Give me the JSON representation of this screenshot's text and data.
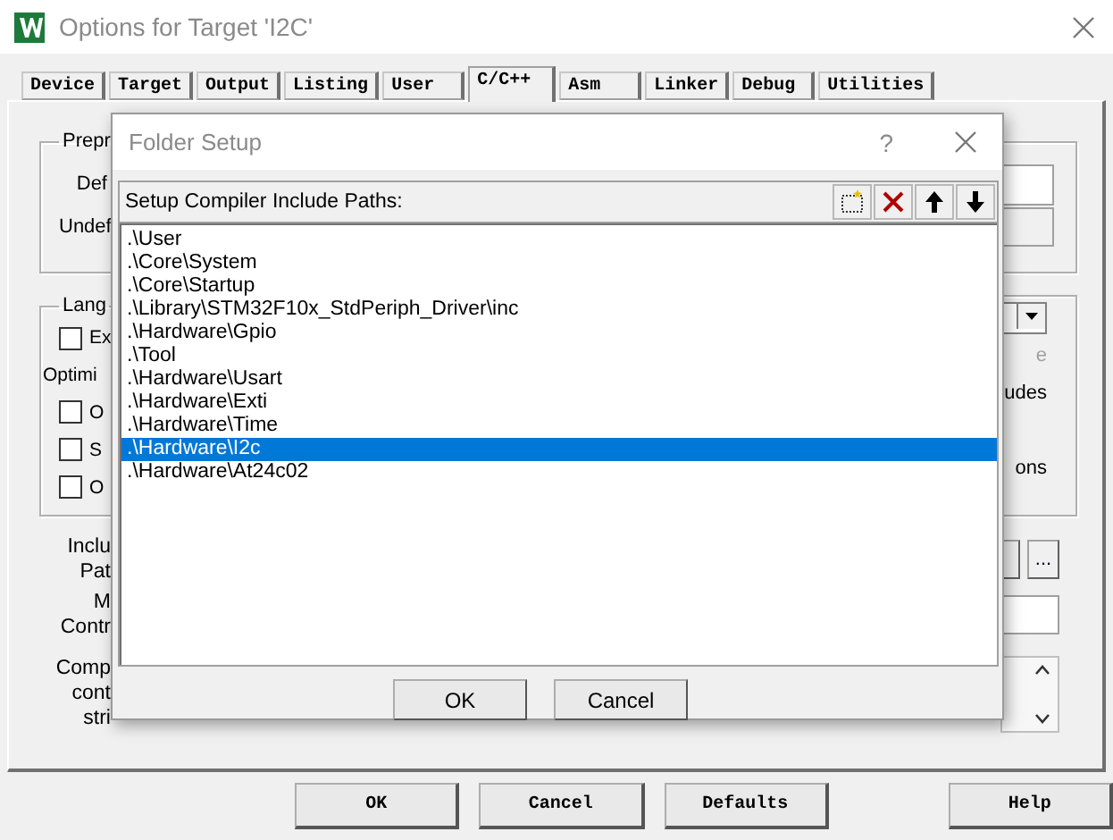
{
  "window": {
    "title": "Options for Target 'I2C'"
  },
  "tabs": [
    {
      "label": "Device",
      "selected": false
    },
    {
      "label": "Target",
      "selected": false
    },
    {
      "label": "Output",
      "selected": false
    },
    {
      "label": "Listing",
      "selected": false
    },
    {
      "label": "User",
      "selected": false
    },
    {
      "label": "C/C++",
      "selected": true
    },
    {
      "label": "Asm",
      "selected": false
    },
    {
      "label": "Linker",
      "selected": false
    },
    {
      "label": "Debug",
      "selected": false
    },
    {
      "label": "Utilities",
      "selected": false
    }
  ],
  "preprocessor": {
    "legend": "Prepr",
    "define_label": "Def",
    "undefine_label": "Undef"
  },
  "language": {
    "legend": "Lang",
    "rows": [
      {
        "left": {
          "kind": "checkbox",
          "label": "Ex",
          "checked": false
        },
        "right": {
          "kind": "dropdown"
        }
      },
      {
        "left": {
          "kind": "label",
          "label": "Optimi"
        },
        "right": {
          "kind": "label",
          "label": "e",
          "disabled": true
        }
      },
      {
        "left": {
          "kind": "checkbox",
          "label": "O",
          "checked": false
        },
        "right": {
          "kind": "label",
          "label": "udes",
          "disabled": false
        }
      },
      {
        "left": {
          "kind": "checkbox",
          "label": "S",
          "checked": false
        }
      },
      {
        "left": {
          "kind": "checkbox",
          "label": "O",
          "checked": false
        },
        "right": {
          "kind": "label",
          "label": "ons",
          "disabled": false
        }
      }
    ]
  },
  "include_paths": {
    "label_lines": [
      "Inclu",
      "Pat"
    ],
    "browse_button": "..."
  },
  "misc_controls": {
    "label_lines": [
      "M",
      "Contr"
    ]
  },
  "compiler_string": {
    "label_lines": [
      "Comp",
      "cont",
      "stri"
    ]
  },
  "buttons": [
    "OK",
    "Cancel",
    "Defaults",
    "Help"
  ],
  "folder_setup": {
    "title": "Folder Setup",
    "help": "?",
    "list_label": "Setup Compiler Include Paths:",
    "paths": [
      {
        "path": ".\\User",
        "selected": false
      },
      {
        "path": ".\\Core\\System",
        "selected": false
      },
      {
        "path": ".\\Core\\Startup",
        "selected": false
      },
      {
        "path": ".\\Library\\STM32F10x_StdPeriph_Driver\\inc",
        "selected": false
      },
      {
        "path": ".\\Hardware\\Gpio",
        "selected": false
      },
      {
        "path": ".\\Tool",
        "selected": false
      },
      {
        "path": ".\\Hardware\\Usart",
        "selected": false
      },
      {
        "path": ".\\Hardware\\Exti",
        "selected": false
      },
      {
        "path": ".\\Hardware\\Time",
        "selected": false
      },
      {
        "path": ".\\Hardware\\I2c",
        "selected": true
      },
      {
        "path": ".\\Hardware\\At24c02",
        "selected": false
      }
    ],
    "buttons": [
      "OK",
      "Cancel"
    ]
  }
}
